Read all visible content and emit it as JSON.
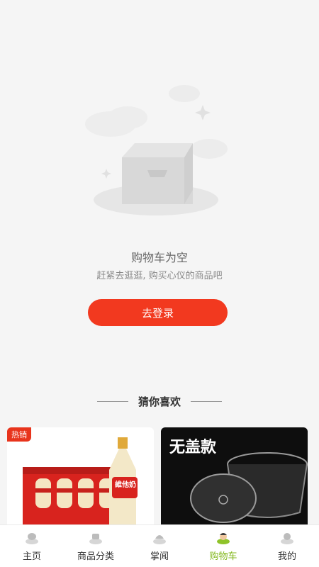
{
  "empty": {
    "title": "购物车为空",
    "subtitle": "赶紧去逛逛, 购买心仪的商品吧",
    "login_button": "去登录"
  },
  "guess": {
    "title": "猜你喜欢",
    "products": [
      {
        "badge": "热销",
        "brand_text": "維他奶"
      },
      {
        "badge": "",
        "headline": "无盖款"
      }
    ]
  },
  "tabbar": {
    "items": [
      {
        "label": "主页",
        "icon": "home-icon"
      },
      {
        "label": "商品分类",
        "icon": "category-icon"
      },
      {
        "label": "掌闻",
        "icon": "news-icon"
      },
      {
        "label": "购物车",
        "icon": "cart-icon",
        "active": true
      },
      {
        "label": "我的",
        "icon": "profile-icon"
      }
    ]
  },
  "colors": {
    "accent": "#f2391f",
    "active_tab": "#84b81f",
    "background": "#f5f5f5"
  }
}
